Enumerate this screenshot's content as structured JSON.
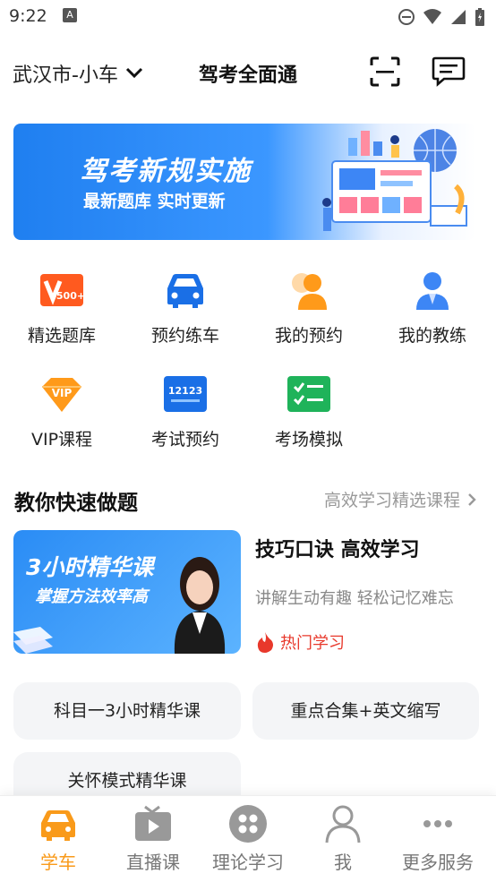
{
  "status": {
    "time": "9:22"
  },
  "header": {
    "city": "武汉市-小车",
    "title": "驾考全面通"
  },
  "banner": {
    "title": "驾考新规实施",
    "subtitle": "最新题库  实时更新"
  },
  "grid": [
    {
      "label": "精选题库",
      "icon": "vip-500-icon"
    },
    {
      "label": "预约练车",
      "icon": "car-icon"
    },
    {
      "label": "我的预约",
      "icon": "user-clock-icon"
    },
    {
      "label": "我的教练",
      "icon": "coach-icon"
    },
    {
      "label": "VIP课程",
      "icon": "vip-diamond-icon"
    },
    {
      "label": "考试预约",
      "icon": "12123-icon"
    },
    {
      "label": "考场模拟",
      "icon": "checklist-icon"
    }
  ],
  "grid_badges": {
    "v500": "500+",
    "vip": "VIP",
    "gov": "12123"
  },
  "section": {
    "title": "教你快速做题",
    "more": "高效学习精选课程"
  },
  "course": {
    "thumb_line1": "3小时精华课",
    "thumb_line2": "掌握方法效率高",
    "title": "技巧口诀 高效学习",
    "desc": "讲解生动有趣 轻松记忆难忘",
    "hot": "热门学习"
  },
  "chips": [
    "科目一3小时精华课",
    "重点合集+英文缩写",
    "关怀模式精华课"
  ],
  "tabs": [
    {
      "label": "学车",
      "active": true
    },
    {
      "label": "直播课",
      "active": false
    },
    {
      "label": "理论学习",
      "active": false
    },
    {
      "label": "我",
      "active": false
    },
    {
      "label": "更多服务",
      "active": false
    }
  ],
  "colors": {
    "accent": "#f99a1a",
    "hot": "#e8382b",
    "banner": "#1f7ff0"
  }
}
